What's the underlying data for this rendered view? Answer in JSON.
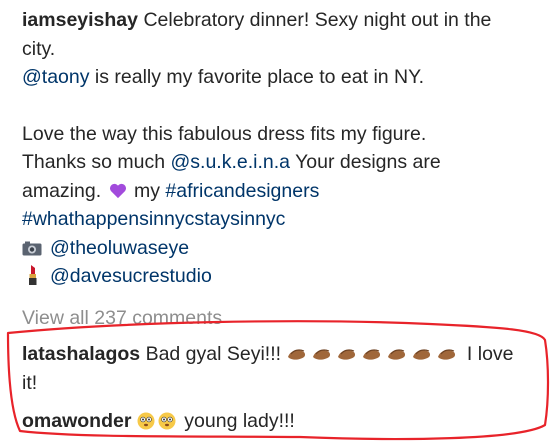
{
  "caption": {
    "username": "iamseyishay",
    "line1": "Celebratory dinner! Sexy night out in the",
    "line2": "city.",
    "mention_place": "@taony",
    "line3_rest": " is really my favorite place to eat in NY.",
    "line4": "Love the way this fabulous dress fits my figure.",
    "line5_start": "Thanks so much ",
    "mention_designer": "@s.u.k.e.i.n.a",
    "line5_end": " Your designs are",
    "line6_start": "amazing.",
    "line6_mid": " my ",
    "hashtag1": "#africandesigners",
    "hashtag2": "#whathappensinnycstaysinnyc",
    "photographer": "@theoluwaseye",
    "makeup": "@davesucrestudio"
  },
  "view_all": "View all 237 comments",
  "comments": [
    {
      "username": "latashalagos",
      "text_start": "Bad gyal Seyi!!!",
      "text_end": "I love",
      "text_wrap": "it!"
    },
    {
      "username": "omawonder",
      "text": "young lady!!!"
    }
  ],
  "colors": {
    "text": "#262626",
    "link": "#003569",
    "muted": "#8e8e8e",
    "annotation": "#e8232a"
  },
  "icons": [
    "purple-heart-icon",
    "camera-icon",
    "lipstick-icon",
    "clapping-hands-icon",
    "flushed-face-icon"
  ]
}
